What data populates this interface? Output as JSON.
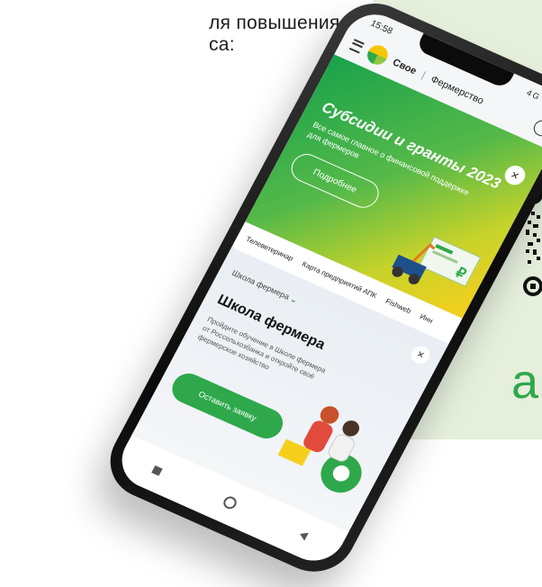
{
  "poster": {
    "line1": "ля повышения",
    "line2": "са:",
    "green_letter": "а"
  },
  "phone": {
    "status": {
      "time": "15:58",
      "indicators": "4G ▮▮"
    },
    "appbar": {
      "menu_icon": "menu-icon",
      "brand": "Свое",
      "separator": "|",
      "section": "Фермерство",
      "user_icon": "user-icon"
    },
    "hero": {
      "title": "Субсидии и гранты 2023",
      "subtitle": "Все самое главное о финансовой поддержке для фермеров",
      "button": "Подробнее",
      "close": "✕"
    },
    "tabs": [
      "Телеветеринар",
      "Карта предприятий АПК",
      "Fishweb",
      "Инн"
    ],
    "school": {
      "dropdown": "Школа фермера ⌄",
      "title": "Школа фермера",
      "text": "Пройдите обучение в Школе фермера от Россельхозбанка и откройте своё фермерское хозяйство",
      "button": "Оставить заявку",
      "close": "✕"
    },
    "navbar": [
      "square-icon",
      "home-circle-icon",
      "back-icon"
    ]
  },
  "colors": {
    "accent_green": "#2ea84b",
    "panel_bg": "#e5efdc",
    "hero_start": "#19a24a",
    "hero_end": "#f6cf1d"
  }
}
